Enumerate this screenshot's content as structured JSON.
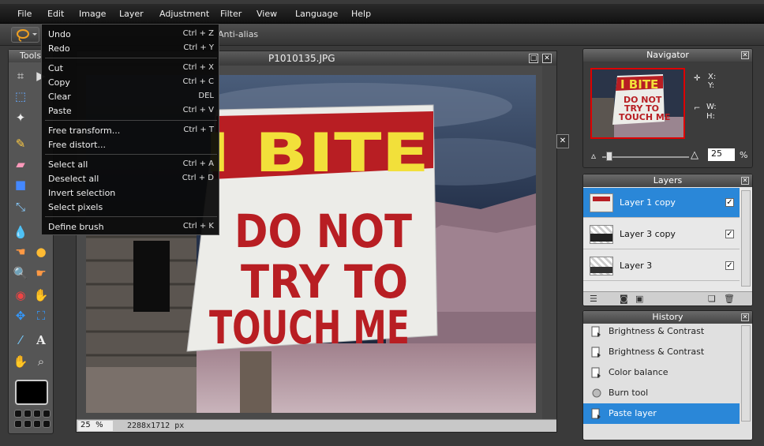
{
  "menubar": {
    "items": [
      "File",
      "Edit",
      "Image",
      "Layer",
      "Adjustment",
      "Filter",
      "View",
      "Language",
      "Help"
    ]
  },
  "options": {
    "antialias_label": "Anti-alias"
  },
  "tools": {
    "title": "Tools"
  },
  "edit_menu": {
    "items": [
      {
        "label": "Undo",
        "shortcut": "Ctrl + Z"
      },
      {
        "label": "Redo",
        "shortcut": "Ctrl + Y"
      },
      {
        "label": "Cut",
        "shortcut": "Ctrl + X"
      },
      {
        "label": "Copy",
        "shortcut": "Ctrl + C"
      },
      {
        "label": "Clear",
        "shortcut": "DEL"
      },
      {
        "label": "Paste",
        "shortcut": "Ctrl + V"
      },
      {
        "label": "Free transform...",
        "shortcut": "Ctrl + T"
      },
      {
        "label": "Free distort...",
        "shortcut": ""
      },
      {
        "label": "Select all",
        "shortcut": "Ctrl + A"
      },
      {
        "label": "Deselect all",
        "shortcut": "Ctrl + D"
      },
      {
        "label": "Invert selection",
        "shortcut": ""
      },
      {
        "label": "Select pixels",
        "shortcut": ""
      },
      {
        "label": "Define brush",
        "shortcut": "Ctrl + K"
      }
    ]
  },
  "document": {
    "title": "P1010135.JPG",
    "zoom": "25",
    "zoom_unit": "%",
    "size": "2288x1712 px",
    "sign": {
      "line1": "I BITE",
      "line2": "DO NOT",
      "line3": "TRY TO",
      "line4": "TOUCH ME"
    }
  },
  "navigator": {
    "title": "Navigator",
    "x_label": "X:",
    "y_label": "Y:",
    "w_label": "W:",
    "h_label": "H:",
    "zoom": "25",
    "zoom_unit": "%",
    "slider_level": 0.05
  },
  "layers": {
    "title": "Layers",
    "items": [
      {
        "name": "Layer 1 copy",
        "visible": true,
        "selected": true
      },
      {
        "name": "Layer 3 copy",
        "visible": true,
        "selected": false
      },
      {
        "name": "Layer 3",
        "visible": true,
        "selected": false
      }
    ]
  },
  "history": {
    "title": "History",
    "items": [
      {
        "label": "Brightness & Contrast",
        "selected": false
      },
      {
        "label": "Brightness & Contrast",
        "selected": false
      },
      {
        "label": "Color balance",
        "selected": false
      },
      {
        "label": "Burn tool",
        "selected": false
      },
      {
        "label": "Paste layer",
        "selected": true
      }
    ]
  },
  "colors": {
    "selection": "#2a87d8",
    "sign_red": "#b81e23",
    "sign_yellow": "#f2e03a"
  }
}
